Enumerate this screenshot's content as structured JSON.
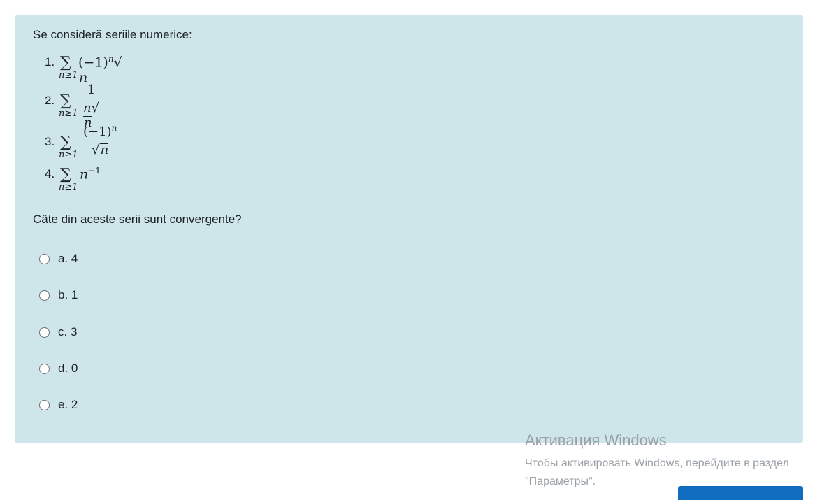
{
  "question": {
    "intro": "Se consideră seriile numerice:",
    "series": [
      {
        "num": "1.",
        "sum_sub": "n≥1"
      },
      {
        "num": "2.",
        "sum_sub": "n≥1"
      },
      {
        "num": "3.",
        "sum_sub": "n≥1"
      },
      {
        "num": "4.",
        "sum_sub": "n≥1"
      }
    ],
    "prompt": "Câte din aceste serii sunt convergente?",
    "options": [
      {
        "label": "a. 4"
      },
      {
        "label": "b. 1"
      },
      {
        "label": "c. 3"
      },
      {
        "label": "d. 0"
      },
      {
        "label": "e. 2"
      }
    ]
  },
  "watermark": {
    "title": "Активация Windows",
    "line1": "Чтобы активировать Windows, перейдите в раздел",
    "line2": "\"Параметры\"."
  }
}
